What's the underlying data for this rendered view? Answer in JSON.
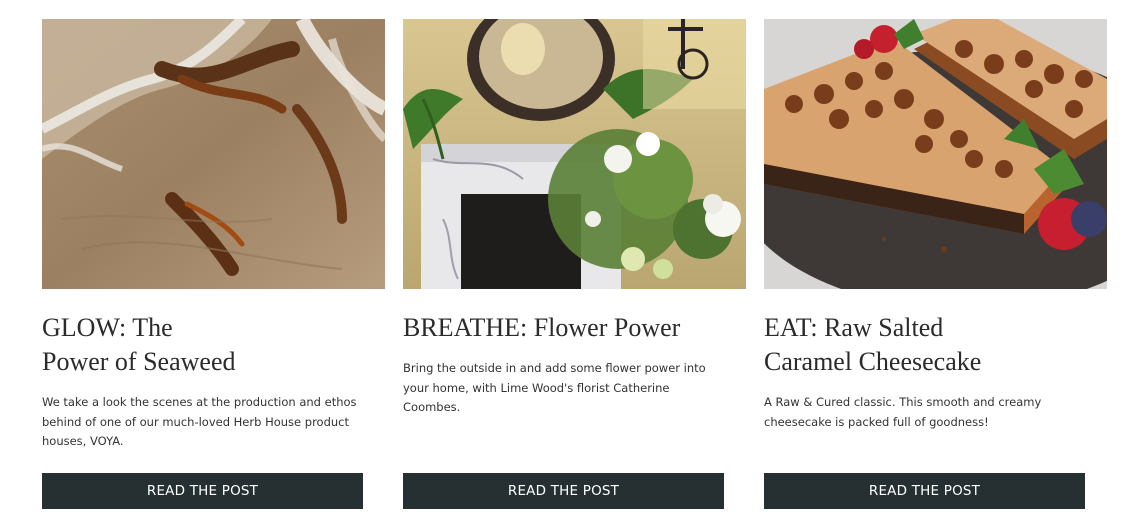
{
  "posts": [
    {
      "image_alt": "Seaweed washed up on wet sand with foam",
      "title_lines": [
        "GLOW: The",
        "Power of Seaweed"
      ],
      "excerpt_lines": [
        "We take a look the scenes at the production and ethos",
        "behind of one of our much-loved Herb House product",
        "houses, VOYA."
      ],
      "button_label": "READ THE POST"
    },
    {
      "image_alt": "Marble fireplace with round mirror, ferns and a white floral arrangement",
      "title_lines": [
        "BREATHE: Flower Power"
      ],
      "excerpt_lines": [
        "Bring the outside in and add some flower power into",
        "your home, with Lime Wood's florist Catherine",
        "Coombes."
      ],
      "button_label": "READ THE POST"
    },
    {
      "image_alt": "Slices of raw salted caramel cheesecake with berries and mint",
      "title_lines": [
        "EAT: Raw Salted",
        "Caramel Cheesecake"
      ],
      "excerpt_lines": [
        "A Raw & Cured classic. This smooth and creamy",
        "cheesecake is packed full of goodness!"
      ],
      "button_label": "READ THE POST"
    }
  ],
  "colors": {
    "button_bg": "#263033",
    "button_text": "#ffffff",
    "title_text": "#2b2b2b",
    "body_text": "#333333"
  }
}
